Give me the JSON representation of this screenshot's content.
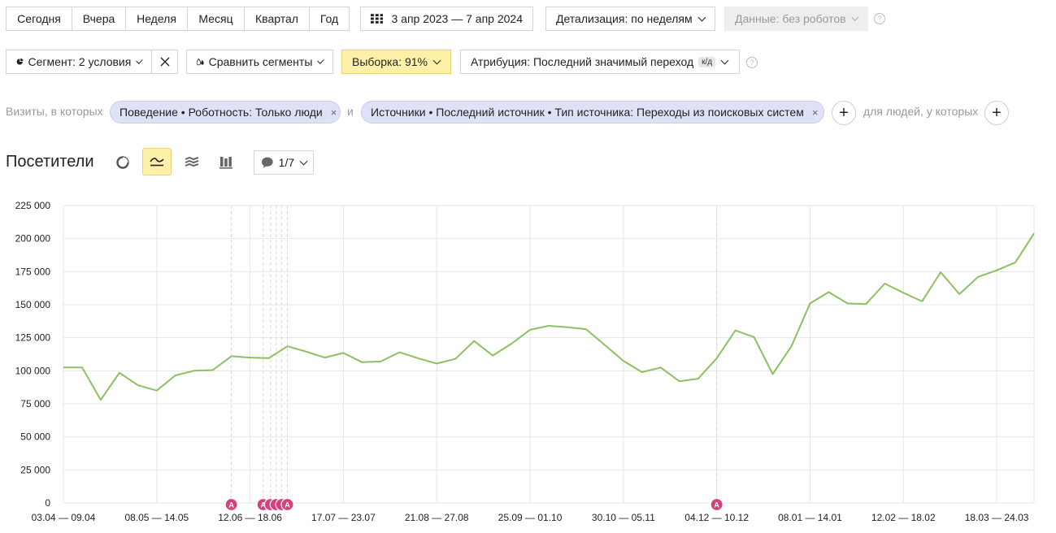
{
  "periods": [
    "Сегодня",
    "Вчера",
    "Неделя",
    "Месяц",
    "Квартал",
    "Год"
  ],
  "date_range": "3 апр 2023 — 7 апр 2024",
  "detail": "Детализация: по неделям",
  "data_filter": "Данные: без роботов",
  "help_glyph": "?",
  "segment": "Сегмент: 2 условия",
  "compare": "Сравнить сегменты",
  "sample": "Выборка: 91%",
  "attribution": "Атрибуция: Последний значимый переход",
  "attribution_badge": "к/д",
  "filters": {
    "lead": "Визиты, в которых",
    "chip1": "Поведение • Роботность: Только люди",
    "conj": "и",
    "chip2": "Источники • Последний источник • Тип источника: Переходы из поисковых систем",
    "people": "для людей, у которых",
    "close_glyph": "×",
    "plus_glyph": "+"
  },
  "section_title": "Посетители",
  "comments": "1/7",
  "annotation_letter": "A",
  "colors": {
    "line": "#8cc060",
    "sample_bg": "#fff1a8",
    "chip_bg": "#dfe1f6",
    "annotation": "#d6407c",
    "disabled_bg": "#eeeeee"
  },
  "chart_data": {
    "type": "line",
    "ylim": [
      0,
      225000
    ],
    "yticks": [
      "0",
      "25 000",
      "50 000",
      "75 000",
      "100 000",
      "125 000",
      "150 000",
      "175 000",
      "200 000",
      "225 000"
    ],
    "xtick_labels": [
      "03.04 — 09.04",
      "08.05 — 14.05",
      "12.06 — 18.06",
      "17.07 — 23.07",
      "21.08 — 27.08",
      "25.09 — 01.10",
      "30.10 — 05.11",
      "04.12 — 10.12",
      "08.01 — 14.01",
      "12.02 — 18.02",
      "18.03 — 24.03"
    ],
    "series": [
      {
        "values": [
          102500,
          102500,
          78000,
          98500,
          89000,
          85000,
          96500,
          100000,
          100500,
          111000,
          110000,
          109500,
          118500,
          114500,
          110000,
          113500,
          106500,
          107000,
          114000,
          109500,
          105500,
          109000,
          122500,
          111500,
          120500,
          131000,
          134000,
          133000,
          131500,
          119500,
          107500,
          99000,
          102500,
          92000,
          94000,
          109500,
          130500,
          125500,
          97500,
          118500,
          151000,
          159500,
          151000,
          150500,
          166000,
          159000,
          152500,
          174500,
          158000,
          171000,
          176000,
          182000,
          204000
        ]
      }
    ],
    "annotation_weeks": [
      9,
      10.7,
      11.1,
      11.4,
      11.7,
      12,
      35
    ],
    "annotation_markers": [
      {
        "week": 9,
        "letter": "A"
      },
      {
        "week": 10.7,
        "letter": "A"
      },
      {
        "week": 11.1,
        "letter": ""
      },
      {
        "week": 11.4,
        "letter": ""
      },
      {
        "week": 11.7,
        "letter": ""
      },
      {
        "week": 12,
        "letter": "A"
      },
      {
        "week": 35,
        "letter": "A"
      }
    ]
  }
}
